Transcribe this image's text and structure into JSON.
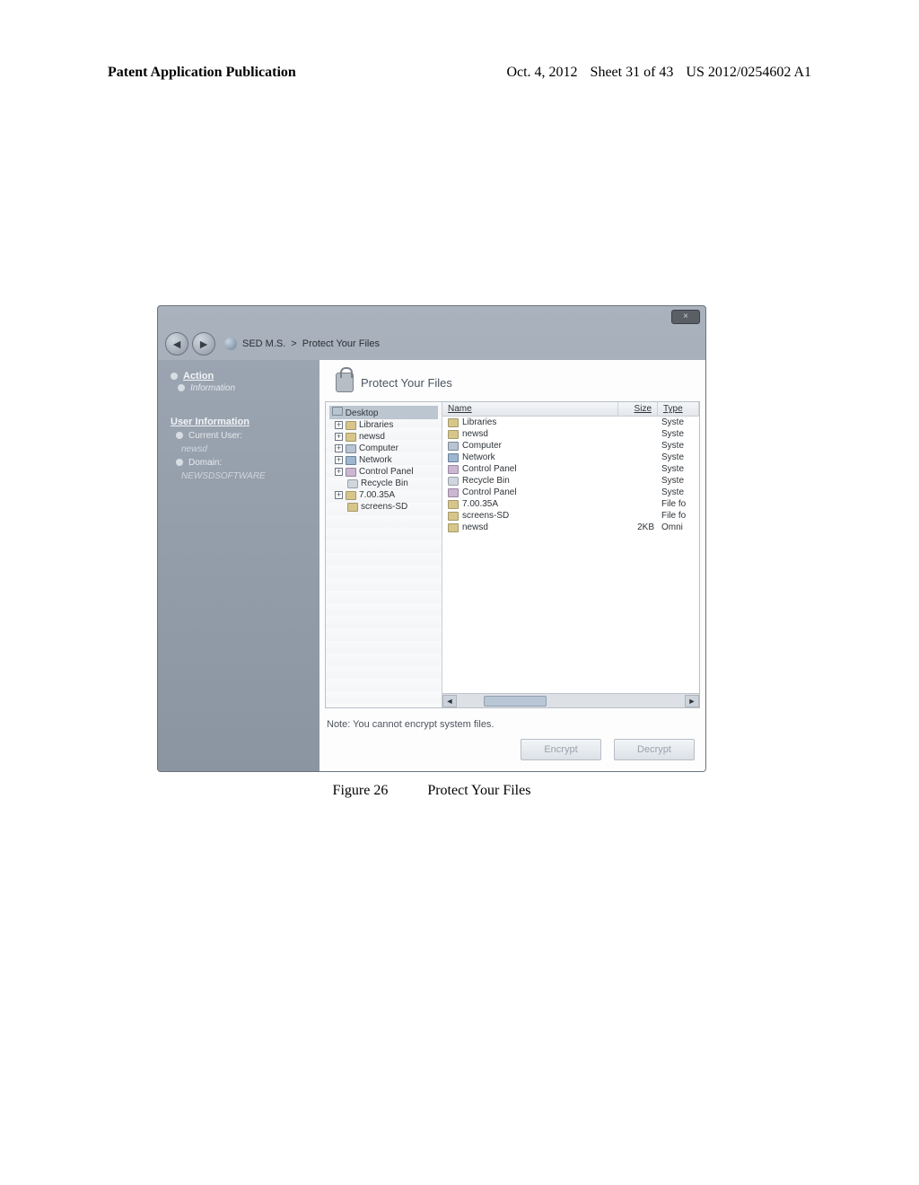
{
  "page_header": {
    "left": "Patent Application Publication",
    "date": "Oct. 4, 2012",
    "sheet": "Sheet 31 of 43",
    "pubno": "US 2012/0254602 A1"
  },
  "window": {
    "breadcrumb_app": "SED M.S.",
    "breadcrumb_sep": ">",
    "breadcrumb_page": "Protect Your Files",
    "close_label": "×"
  },
  "sidebar": {
    "cat1": "Action",
    "item1": "Information",
    "cat2": "User Information",
    "label_user": "Current User:",
    "val_user": "newsd",
    "label_domain": "Domain:",
    "val_domain": "NEWSDSOFTWARE"
  },
  "main": {
    "title": "Protect Your Files",
    "note": "Note: You cannot encrypt system files.",
    "btn_encrypt": "Encrypt",
    "btn_decrypt": "Decrypt"
  },
  "tree": {
    "root": "Desktop",
    "n0": "Libraries",
    "n1": "newsd",
    "n2": "Computer",
    "n3": "Network",
    "n4": "Control Panel",
    "n5": "Recycle Bin",
    "n6": "7.00.35A",
    "n7": "screens-SD"
  },
  "list": {
    "head_name": "Name",
    "head_size": "Size",
    "head_type": "Type",
    "rows": [
      {
        "name": "Libraries",
        "size": "",
        "type": "Syste"
      },
      {
        "name": "newsd",
        "size": "",
        "type": "Syste"
      },
      {
        "name": "Computer",
        "size": "",
        "type": "Syste"
      },
      {
        "name": "Network",
        "size": "",
        "type": "Syste"
      },
      {
        "name": "Control Panel",
        "size": "",
        "type": "Syste"
      },
      {
        "name": "Recycle Bin",
        "size": "",
        "type": "Syste"
      },
      {
        "name": "Control Panel",
        "size": "",
        "type": "Syste"
      },
      {
        "name": "7.00.35A",
        "size": "",
        "type": "File fo"
      },
      {
        "name": "screens-SD",
        "size": "",
        "type": "File fo"
      },
      {
        "name": "newsd",
        "size": "2KB",
        "type": "Omni"
      }
    ]
  },
  "caption": {
    "fignum": "Figure 26",
    "text": "Protect Your Files"
  }
}
